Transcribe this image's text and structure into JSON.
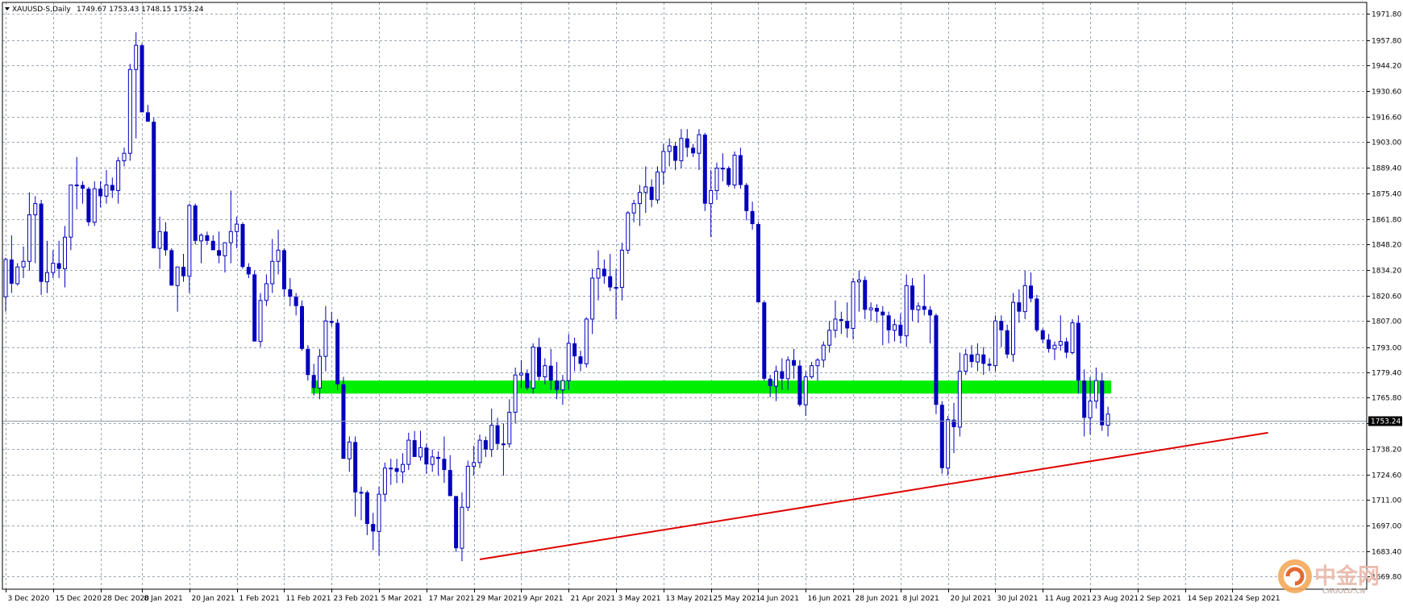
{
  "header": {
    "symbol_title": "XAUUSD-S,Daily",
    "ohlc": "1749.67 1753.43 1748.15 1753.24"
  },
  "colors": {
    "candle": "#0000bb",
    "support_zone": "#00ee00",
    "trendline": "#e00000",
    "grid": "#9aa6b2",
    "background": "#ffffff",
    "price_tag_bg": "#000000",
    "price_tag_text": "#ffffff"
  },
  "price_axis": {
    "ticks": [
      "1971.80",
      "1957.80",
      "1944.20",
      "1930.60",
      "1916.60",
      "1903.00",
      "1889.40",
      "1875.40",
      "1861.80",
      "1848.20",
      "1834.20",
      "1820.60",
      "1807.00",
      "1793.00",
      "1779.40",
      "1765.80",
      "1752.20",
      "1738.20",
      "1724.60",
      "1711.00",
      "1697.00",
      "1683.40",
      "1669.80"
    ],
    "current_price": "1753.24"
  },
  "time_axis": {
    "labels": [
      "3 Dec 2020",
      "15 Dec 2020",
      "28 Dec 2020",
      "8 Jan 2021",
      "20 Jan 2021",
      "1 Feb 2021",
      "11 Feb 2021",
      "23 Feb 2021",
      "5 Mar 2021",
      "17 Mar 2021",
      "29 Mar 2021",
      "9 Apr 2021",
      "21 Apr 2021",
      "3 May 2021",
      "13 May 2021",
      "25 May 2021",
      "4 Jun 2021",
      "16 Jun 2021",
      "28 Jun 2021",
      "8 Jul 2021",
      "20 Jul 2021",
      "30 Jul 2021",
      "11 Aug 2021",
      "23 Aug 2021",
      "2 Sep 2021",
      "14 Sep 2021",
      "24 Sep 2021"
    ]
  },
  "watermark": {
    "brand": "中金网",
    "sub": "CNGOLD.CN"
  },
  "chart_data": {
    "type": "candlestick",
    "title": "XAUUSD-S,Daily",
    "ylim": [
      1663,
      1978
    ],
    "y_ticks": [
      1971.8,
      1957.8,
      1944.2,
      1930.6,
      1916.6,
      1903.0,
      1889.4,
      1875.4,
      1861.8,
      1848.2,
      1834.2,
      1820.6,
      1807.0,
      1793.0,
      1779.4,
      1765.8,
      1752.2,
      1738.2,
      1724.6,
      1711.0,
      1697.0,
      1683.4,
      1669.8
    ],
    "x_ticks": [
      {
        "label": "3 Dec 2020",
        "index": 0
      },
      {
        "label": "15 Dec 2020",
        "index": 8
      },
      {
        "label": "28 Dec 2020",
        "index": 16
      },
      {
        "label": "8 Jan 2021",
        "index": 23
      },
      {
        "label": "20 Jan 2021",
        "index": 31
      },
      {
        "label": "1 Feb 2021",
        "index": 39
      },
      {
        "label": "11 Feb 2021",
        "index": 47
      },
      {
        "label": "23 Feb 2021",
        "index": 55
      },
      {
        "label": "5 Mar 2021",
        "index": 63
      },
      {
        "label": "17 Mar 2021",
        "index": 71
      },
      {
        "label": "29 Mar 2021",
        "index": 79
      },
      {
        "label": "9 Apr 2021",
        "index": 87
      },
      {
        "label": "21 Apr 2021",
        "index": 95
      },
      {
        "label": "3 May 2021",
        "index": 103
      },
      {
        "label": "13 May 2021",
        "index": 111
      },
      {
        "label": "25 May 2021",
        "index": 119
      },
      {
        "label": "4 Jun 2021",
        "index": 127
      },
      {
        "label": "16 Jun 2021",
        "index": 135
      },
      {
        "label": "28 Jun 2021",
        "index": 143
      },
      {
        "label": "8 Jul 2021",
        "index": 151
      },
      {
        "label": "20 Jul 2021",
        "index": 159
      },
      {
        "label": "30 Jul 2021",
        "index": 167
      },
      {
        "label": "11 Aug 2021",
        "index": 175
      },
      {
        "label": "23 Aug 2021",
        "index": 183
      },
      {
        "label": "2 Sep 2021",
        "index": 191
      },
      {
        "label": "14 Sep 2021",
        "index": 199
      },
      {
        "label": "24 Sep 2021",
        "index": 207
      }
    ],
    "ohlc": [
      [
        1820,
        1841,
        1812,
        1840
      ],
      [
        1840,
        1853,
        1822,
        1827
      ],
      [
        1827,
        1838,
        1826,
        1836
      ],
      [
        1836,
        1847,
        1830,
        1839
      ],
      [
        1839,
        1876,
        1834,
        1864
      ],
      [
        1864,
        1874,
        1838,
        1870
      ],
      [
        1870,
        1872,
        1821,
        1828
      ],
      [
        1828,
        1850,
        1822,
        1833
      ],
      [
        1833,
        1845,
        1830,
        1838
      ],
      [
        1838,
        1850,
        1830,
        1835
      ],
      [
        1835,
        1858,
        1825,
        1852
      ],
      [
        1852,
        1880,
        1845,
        1880
      ],
      [
        1880,
        1895,
        1867,
        1880
      ],
      [
        1880,
        1882,
        1870,
        1878
      ],
      [
        1878,
        1879,
        1858,
        1860
      ],
      [
        1860,
        1882,
        1858,
        1878
      ],
      [
        1878,
        1882,
        1868,
        1874
      ],
      [
        1874,
        1888,
        1870,
        1880
      ],
      [
        1880,
        1884,
        1873,
        1877
      ],
      [
        1877,
        1895,
        1870,
        1893
      ],
      [
        1893,
        1900,
        1890,
        1897
      ],
      [
        1897,
        1945,
        1893,
        1942
      ],
      [
        1942,
        1962,
        1905,
        1955
      ],
      [
        1955,
        1956,
        1919,
        1919
      ],
      [
        1919,
        1923,
        1914,
        1914
      ],
      [
        1914,
        1916,
        1846,
        1846
      ],
      [
        1846,
        1863,
        1835,
        1855
      ],
      [
        1855,
        1860,
        1842,
        1845
      ],
      [
        1845,
        1846,
        1826,
        1826
      ],
      [
        1826,
        1836,
        1812,
        1836
      ],
      [
        1836,
        1843,
        1828,
        1831
      ],
      [
        1831,
        1870,
        1822,
        1869
      ],
      [
        1869,
        1870,
        1848,
        1850
      ],
      [
        1850,
        1854,
        1838,
        1853
      ],
      [
        1853,
        1855,
        1848,
        1850
      ],
      [
        1850,
        1853,
        1845,
        1845
      ],
      [
        1845,
        1855,
        1838,
        1842
      ],
      [
        1842,
        1849,
        1833,
        1849
      ],
      [
        1849,
        1877,
        1838,
        1855
      ],
      [
        1855,
        1863,
        1846,
        1859
      ],
      [
        1859,
        1860,
        1835,
        1836
      ],
      [
        1836,
        1838,
        1830,
        1832
      ],
      [
        1832,
        1834,
        1796,
        1796
      ],
      [
        1796,
        1822,
        1793,
        1818
      ],
      [
        1818,
        1832,
        1815,
        1827
      ],
      [
        1827,
        1851,
        1822,
        1839
      ],
      [
        1839,
        1856,
        1832,
        1845
      ],
      [
        1845,
        1846,
        1820,
        1824
      ],
      [
        1824,
        1830,
        1815,
        1820
      ],
      [
        1820,
        1822,
        1810,
        1815
      ],
      [
        1815,
        1818,
        1791,
        1792
      ],
      [
        1792,
        1794,
        1775,
        1778
      ],
      [
        1778,
        1784,
        1767,
        1771
      ],
      [
        1771,
        1792,
        1765,
        1788
      ],
      [
        1788,
        1815,
        1780,
        1807
      ],
      [
        1807,
        1812,
        1804,
        1806
      ],
      [
        1806,
        1808,
        1770,
        1773
      ],
      [
        1773,
        1777,
        1733,
        1733
      ],
      [
        1733,
        1745,
        1726,
        1742
      ],
      [
        1742,
        1745,
        1702,
        1715
      ],
      [
        1715,
        1718,
        1700,
        1715
      ],
      [
        1715,
        1716,
        1692,
        1698
      ],
      [
        1698,
        1704,
        1684,
        1694
      ],
      [
        1694,
        1718,
        1681,
        1714
      ],
      [
        1714,
        1731,
        1710,
        1728
      ],
      [
        1728,
        1733,
        1719,
        1728
      ],
      [
        1728,
        1733,
        1720,
        1726
      ],
      [
        1726,
        1736,
        1720,
        1730
      ],
      [
        1730,
        1747,
        1727,
        1743
      ],
      [
        1743,
        1748,
        1734,
        1734
      ],
      [
        1734,
        1748,
        1732,
        1739
      ],
      [
        1739,
        1741,
        1725,
        1730
      ],
      [
        1730,
        1738,
        1726,
        1734
      ],
      [
        1734,
        1737,
        1724,
        1733
      ],
      [
        1733,
        1745,
        1720,
        1727
      ],
      [
        1727,
        1735,
        1713,
        1713
      ],
      [
        1713,
        1713,
        1683,
        1685
      ],
      [
        1685,
        1715,
        1678,
        1707
      ],
      [
        1707,
        1732,
        1705,
        1729
      ],
      [
        1729,
        1740,
        1724,
        1731
      ],
      [
        1731,
        1746,
        1728,
        1743
      ],
      [
        1743,
        1745,
        1734,
        1738
      ],
      [
        1738,
        1760,
        1734,
        1751
      ],
      [
        1751,
        1755,
        1738,
        1741
      ],
      [
        1741,
        1752,
        1724,
        1741
      ],
      [
        1741,
        1765,
        1739,
        1758
      ],
      [
        1758,
        1782,
        1752,
        1778
      ],
      [
        1778,
        1786,
        1771,
        1779
      ],
      [
        1779,
        1781,
        1770,
        1771
      ],
      [
        1771,
        1795,
        1768,
        1793
      ],
      [
        1793,
        1798,
        1775,
        1777
      ],
      [
        1777,
        1787,
        1773,
        1783
      ],
      [
        1783,
        1792,
        1770,
        1775
      ],
      [
        1775,
        1785,
        1765,
        1770
      ],
      [
        1770,
        1778,
        1762,
        1775
      ],
      [
        1775,
        1800,
        1770,
        1795
      ],
      [
        1795,
        1798,
        1780,
        1788
      ],
      [
        1788,
        1791,
        1780,
        1784
      ],
      [
        1784,
        1809,
        1782,
        1808
      ],
      [
        1808,
        1835,
        1800,
        1830
      ],
      [
        1830,
        1845,
        1818,
        1835
      ],
      [
        1835,
        1840,
        1827,
        1831
      ],
      [
        1831,
        1843,
        1823,
        1825
      ],
      [
        1825,
        1835,
        1808,
        1825
      ],
      [
        1825,
        1849,
        1818,
        1845
      ],
      [
        1845,
        1866,
        1843,
        1865
      ],
      [
        1865,
        1872,
        1860,
        1870
      ],
      [
        1870,
        1880,
        1858,
        1876
      ],
      [
        1876,
        1890,
        1865,
        1879
      ],
      [
        1879,
        1883,
        1868,
        1872
      ],
      [
        1872,
        1890,
        1870,
        1887
      ],
      [
        1887,
        1902,
        1880,
        1898
      ],
      [
        1898,
        1905,
        1890,
        1901
      ],
      [
        1901,
        1903,
        1888,
        1893
      ],
      [
        1893,
        1910,
        1889,
        1905
      ],
      [
        1905,
        1910,
        1895,
        1900
      ],
      [
        1900,
        1902,
        1895,
        1897
      ],
      [
        1897,
        1910,
        1888,
        1907
      ],
      [
        1907,
        1908,
        1866,
        1870
      ],
      [
        1870,
        1888,
        1852,
        1877
      ],
      [
        1877,
        1892,
        1872,
        1889
      ],
      [
        1889,
        1897,
        1882,
        1889
      ],
      [
        1889,
        1890,
        1879,
        1880
      ],
      [
        1880,
        1898,
        1878,
        1896
      ],
      [
        1896,
        1900,
        1878,
        1880
      ],
      [
        1880,
        1881,
        1861,
        1866
      ],
      [
        1866,
        1871,
        1856,
        1859
      ],
      [
        1859,
        1860,
        1817,
        1817
      ],
      [
        1817,
        1818,
        1775,
        1776
      ],
      [
        1776,
        1778,
        1766,
        1772
      ],
      [
        1772,
        1783,
        1764,
        1780
      ],
      [
        1780,
        1787,
        1770,
        1776
      ],
      [
        1776,
        1788,
        1770,
        1786
      ],
      [
        1786,
        1792,
        1776,
        1783
      ],
      [
        1783,
        1786,
        1761,
        1762
      ],
      [
        1762,
        1780,
        1756,
        1777
      ],
      [
        1777,
        1785,
        1776,
        1783
      ],
      [
        1783,
        1787,
        1775,
        1786
      ],
      [
        1786,
        1796,
        1782,
        1794
      ],
      [
        1794,
        1807,
        1790,
        1802
      ],
      [
        1802,
        1818,
        1798,
        1808
      ],
      [
        1808,
        1812,
        1800,
        1807
      ],
      [
        1807,
        1817,
        1798,
        1803
      ],
      [
        1803,
        1830,
        1797,
        1828
      ],
      [
        1828,
        1834,
        1812,
        1829
      ],
      [
        1829,
        1831,
        1808,
        1813
      ],
      [
        1813,
        1817,
        1807,
        1814
      ],
      [
        1814,
        1816,
        1806,
        1812
      ],
      [
        1812,
        1815,
        1794,
        1810
      ],
      [
        1810,
        1812,
        1795,
        1802
      ],
      [
        1802,
        1808,
        1796,
        1805
      ],
      [
        1805,
        1811,
        1795,
        1799
      ],
      [
        1799,
        1832,
        1793,
        1826
      ],
      [
        1826,
        1830,
        1807,
        1813
      ],
      [
        1813,
        1817,
        1806,
        1815
      ],
      [
        1815,
        1832,
        1810,
        1813
      ],
      [
        1813,
        1815,
        1795,
        1810
      ],
      [
        1810,
        1811,
        1757,
        1762
      ],
      [
        1762,
        1764,
        1725,
        1728
      ],
      [
        1728,
        1756,
        1724,
        1754
      ],
      [
        1754,
        1763,
        1736,
        1750
      ],
      [
        1750,
        1790,
        1745,
        1780
      ],
      [
        1780,
        1792,
        1778,
        1789
      ],
      [
        1789,
        1794,
        1782,
        1785
      ],
      [
        1785,
        1795,
        1780,
        1789
      ],
      [
        1789,
        1793,
        1778,
        1784
      ],
      [
        1784,
        1787,
        1780,
        1783
      ],
      [
        1783,
        1810,
        1780,
        1807
      ],
      [
        1807,
        1810,
        1793,
        1802
      ],
      [
        1802,
        1805,
        1787,
        1789
      ],
      [
        1789,
        1822,
        1785,
        1817
      ],
      [
        1817,
        1824,
        1806,
        1812
      ],
      [
        1812,
        1834,
        1808,
        1826
      ],
      [
        1826,
        1833,
        1817,
        1819
      ],
      [
        1819,
        1821,
        1801,
        1802
      ],
      [
        1802,
        1803,
        1795,
        1797
      ],
      [
        1797,
        1800,
        1790,
        1792
      ],
      [
        1792,
        1796,
        1786,
        1794
      ],
      [
        1794,
        1810,
        1791,
        1796
      ],
      [
        1796,
        1798,
        1787,
        1790
      ],
      [
        1790,
        1808,
        1789,
        1806
      ],
      [
        1806,
        1810,
        1768,
        1775
      ],
      [
        1775,
        1781,
        1745,
        1755
      ],
      [
        1755,
        1777,
        1746,
        1764
      ],
      [
        1764,
        1782,
        1760,
        1775
      ],
      [
        1775,
        1779,
        1748,
        1751
      ],
      [
        1751,
        1761,
        1745,
        1757
      ]
    ],
    "horizontal_zone": {
      "from": 1768,
      "to": 1775,
      "start_index": 52
    },
    "trendline": {
      "start": {
        "index": 80,
        "price": 1679
      },
      "end": {
        "index": 213,
        "price": 1747
      }
    },
    "current_price": 1753.24
  }
}
